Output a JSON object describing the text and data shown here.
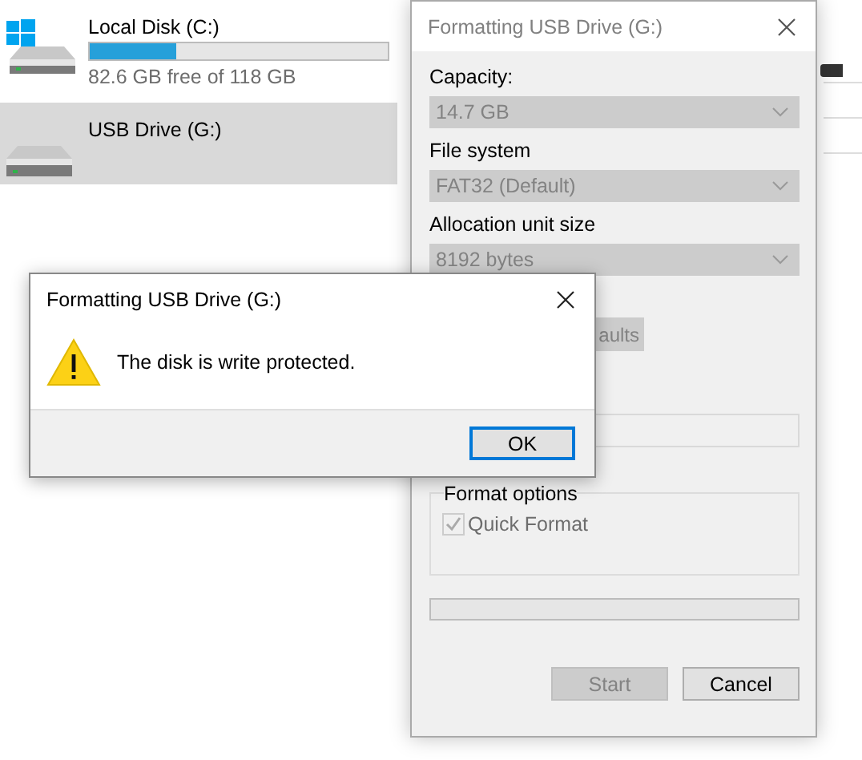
{
  "explorer": {
    "drives": [
      {
        "kind": "system",
        "name": "Local Disk (C:)",
        "level": 0.29,
        "free": "82.6 GB free of 118 GB",
        "selected": false
      },
      {
        "kind": "removable",
        "name": "USB Drive (G:)",
        "selected": true
      }
    ]
  },
  "format_dialog": {
    "title": "Formatting USB Drive (G:)",
    "fields": [
      {
        "label": "Capacity:",
        "value": "14.7 GB",
        "disabled": true
      },
      {
        "label": "File system",
        "value": "FAT32 (Default)",
        "disabled": true
      },
      {
        "label": "Allocation unit size",
        "value": "8192 bytes",
        "disabled": true
      }
    ],
    "restore_button": {
      "label": "aults",
      "disabled": true
    },
    "format_options": {
      "label": "Format options",
      "quick_format": {
        "label": "Quick Format",
        "checked": true,
        "disabled": true
      }
    },
    "progress": {
      "level": 0
    },
    "buttons": [
      {
        "label": "Start",
        "disabled": true
      },
      {
        "label": "Cancel",
        "disabled": false
      }
    ]
  },
  "message_box": {
    "title": "Formatting USB Drive (G:)",
    "message": "The disk is write protected.",
    "button": "OK"
  }
}
